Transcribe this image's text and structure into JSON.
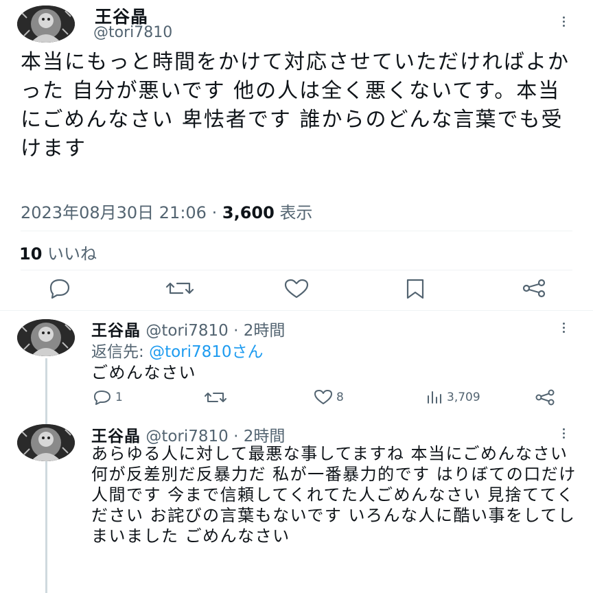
{
  "tweet": {
    "author_name": "王谷晶",
    "author_handle": "@tori7810",
    "text": "本当にもっと時間をかけて対応させていただければよかった 自分が悪いです 他の人は全く悪くないてす。本当にごめんなさい 卑怯者です 誰からのどんな言葉でも受けます",
    "timestamp": "2023年08月30日 21:06",
    "separator": "·",
    "views_count": "3,600",
    "views_label": "表示",
    "likes_count": "10",
    "likes_label": "いいね"
  },
  "replies": [
    {
      "author_name": "王谷晶",
      "author_handle": "@tori7810",
      "time": "· 2時間",
      "replying_prefix": "返信先:",
      "replying_to": "@tori7810さん",
      "text": "ごめんなさい",
      "reply_count": "1",
      "like_count": "8",
      "view_count": "3,709"
    },
    {
      "author_name": "王谷晶",
      "author_handle": "@tori7810",
      "time": "· 2時間",
      "text": "あらゆる人に対して最悪な事してますね 本当にごめんなさい 何が反差別だ反暴力だ 私が一番暴力的です はりぼての口だけ人間です 今まで信頼してくれてた人ごめんなさい 見捨ててください お詫びの言葉もないです いろんな人に酷い事をしてしまいました ごめんなさい"
    }
  ],
  "icons": {
    "reply": "reply-icon",
    "retweet": "retweet-icon",
    "like": "heart-icon",
    "bookmark": "bookmark-icon",
    "share": "share-icon",
    "views": "views-icon",
    "more": "more-icon"
  },
  "colors": {
    "text": "#0f1419",
    "secondary": "#536471",
    "link": "#1d9bf0",
    "divider": "#eff3f4"
  }
}
